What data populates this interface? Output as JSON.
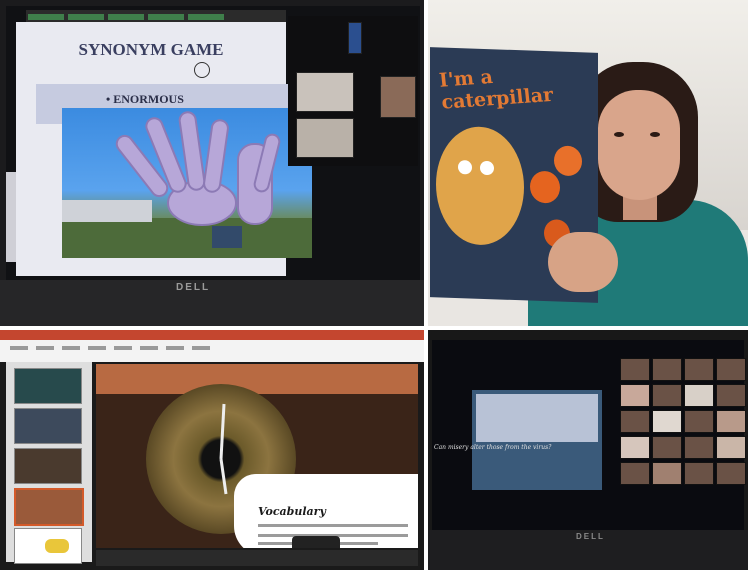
{
  "panels": {
    "synonym_game": {
      "slide_title": "SYNONYM GAME",
      "slide_word": "• ENORMOUS",
      "laptop_brand": "DELL"
    },
    "reading": {
      "book_title": "I'm a caterpillar"
    },
    "vocabulary_slide": {
      "heading": "Vocabulary"
    },
    "zoom_gallery": {
      "caption": "Can misery alter those from the virus?",
      "laptop_brand": "DELL"
    }
  }
}
